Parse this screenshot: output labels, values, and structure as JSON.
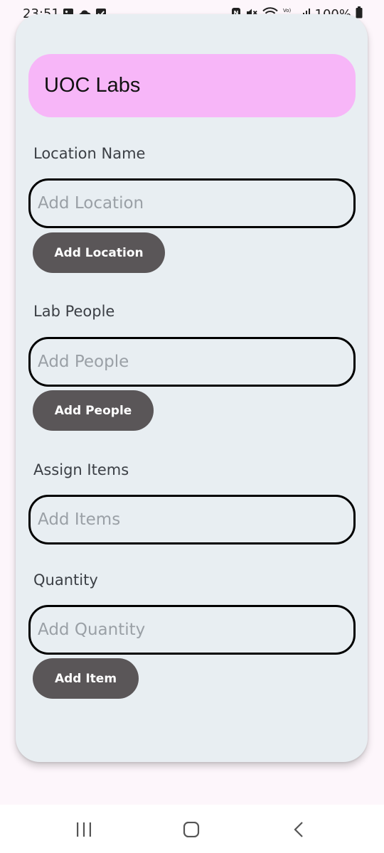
{
  "status_bar": {
    "time": "23:51",
    "battery_text": "100%"
  },
  "header": {
    "title": "UOC Labs",
    "color": "#f7b6f8"
  },
  "form": {
    "location": {
      "label": "Location Name",
      "placeholder": "Add Location",
      "button_label": "Add Location"
    },
    "people": {
      "label": "Lab People",
      "placeholder": "Add People",
      "button_label": "Add People"
    },
    "items": {
      "label": "Assign Items",
      "placeholder": "Add Items"
    },
    "quantity": {
      "label": "Quantity",
      "placeholder": "Add Quantity",
      "button_label": "Add Item"
    }
  },
  "colors": {
    "card_background": "#e8eef2",
    "button_background": "#5a5658",
    "page_background": "#fdf6fb"
  },
  "icons": {
    "status_left": [
      "image-icon",
      "cloud-icon",
      "checkbox-icon"
    ],
    "status_right": [
      "nfc-icon",
      "mute-icon",
      "wifi-icon",
      "volte-icon",
      "signal-icon",
      "battery-icon"
    ],
    "nav": [
      "recent-apps-icon",
      "home-icon",
      "back-icon"
    ]
  }
}
